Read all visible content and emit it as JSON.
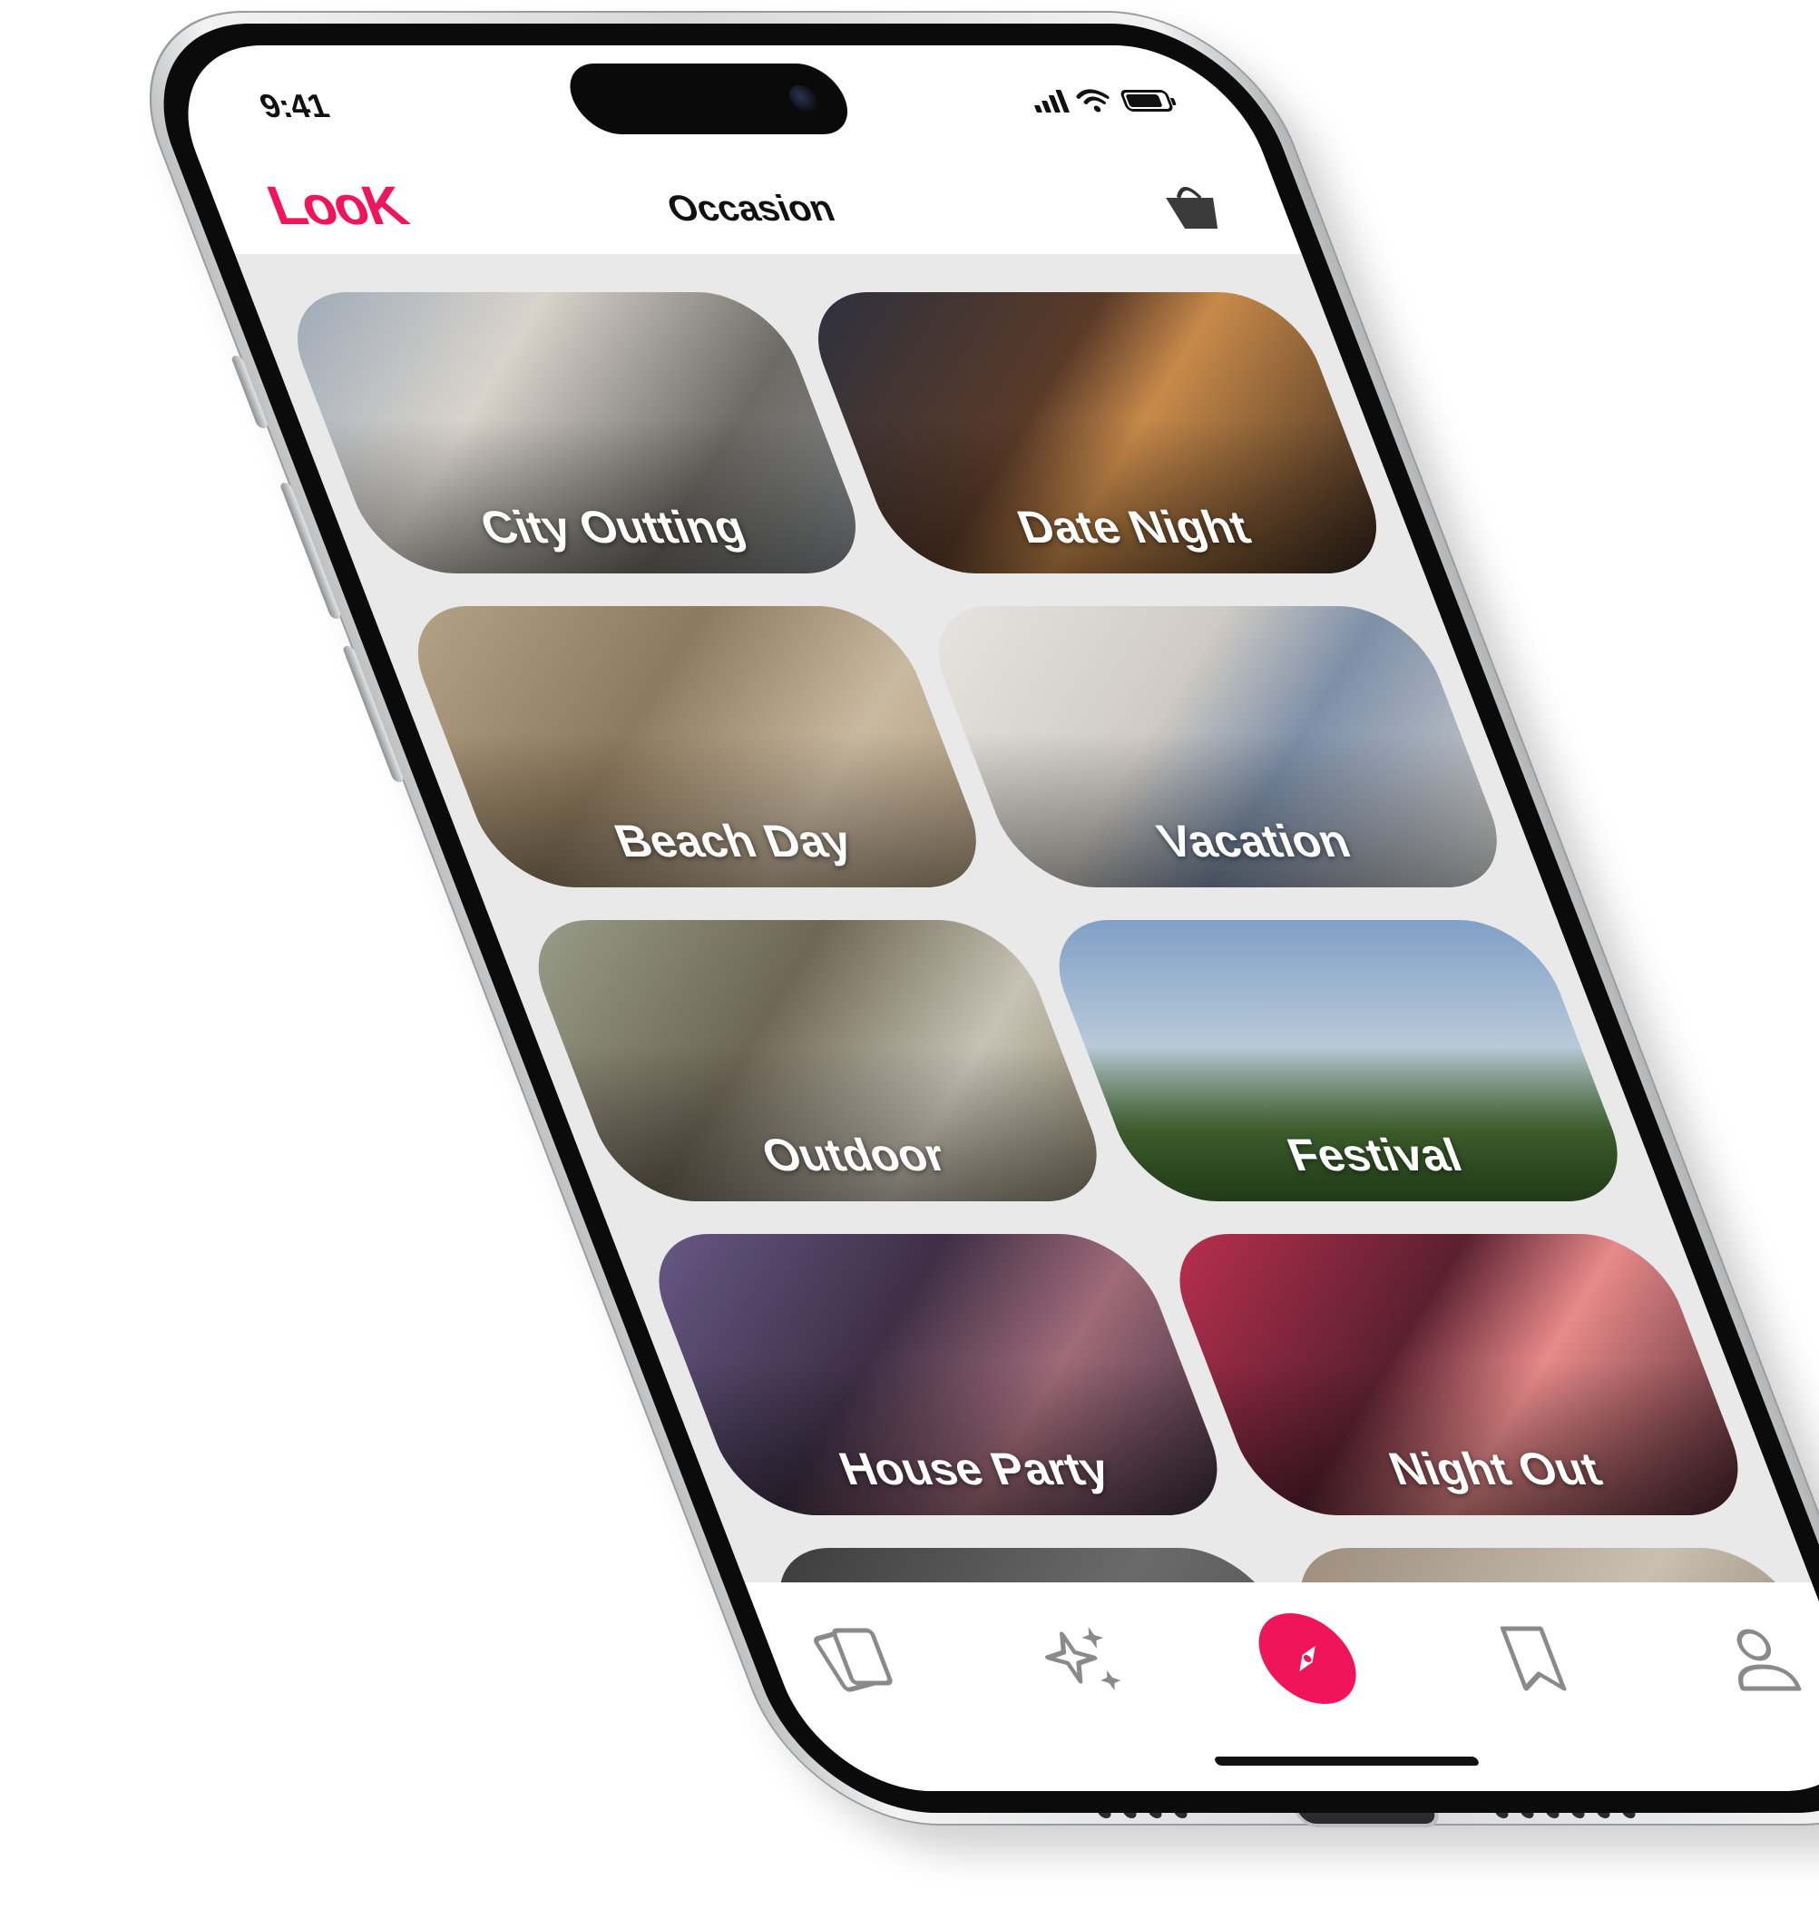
{
  "status_bar": {
    "time": "9:41"
  },
  "header": {
    "logo": "LooK",
    "title": "Occasion",
    "cart_icon": "shopping-basket-icon"
  },
  "colors": {
    "accent": "#f0155a",
    "background": "#e9e9e9"
  },
  "occasions": [
    {
      "label": "City Outting",
      "gradient": "linear-gradient(135deg,#9aa6b5 0%,#d8d4cc 35%,#6c6a64 70%,#8b8f94 100%)"
    },
    {
      "label": "Date Night",
      "gradient": "linear-gradient(135deg,#2a3040 0%,#5a3a28 40%,#c88a4a 55%,#2a1e18 100%)"
    },
    {
      "label": "Beach Day",
      "gradient": "linear-gradient(135deg,#b8a488 0%,#8d7a5e 40%,#c9b9a0 70%,#a89478 100%)"
    },
    {
      "label": "Vacation",
      "gradient": "linear-gradient(135deg,#e8e6e2 0%,#cfcbc4 40%,#7d8fa8 60%,#e0ddd8 100%)"
    },
    {
      "label": "Outdoor",
      "gradient": "linear-gradient(135deg,#9aa08c 0%,#6e6656 40%,#c7c2b4 70%,#857a66 100%)"
    },
    {
      "label": "Festival",
      "gradient": "linear-gradient(180deg,#7fa0c8 0%,#b9c9d8 45%,#4e7a3a 75%,#3c6a2c 100%)"
    },
    {
      "label": "House Party",
      "gradient": "linear-gradient(135deg,#6a5a8a 0%,#3e2f45 40%,#a06a7a 65%,#2e2530 100%)"
    },
    {
      "label": "Night Out",
      "gradient": "linear-gradient(135deg,#c03050 0%,#5a2030 40%,#e88a8a 60%,#3a1a24 100%)"
    },
    {
      "label": "",
      "gradient": "linear-gradient(135deg,#3a3a3a 0%,#6a6a6a 50%,#4a4a4a 100%)"
    },
    {
      "label": "",
      "gradient": "linear-gradient(135deg,#9a8a7a 0%,#c9c0b0 50%,#7a6a5a 100%)"
    }
  ],
  "tab_bar": {
    "tabs": [
      {
        "icon": "cards-icon"
      },
      {
        "icon": "sparkles-icon"
      },
      {
        "icon": "compass-icon",
        "active": true
      },
      {
        "icon": "bookmark-icon"
      },
      {
        "icon": "profile-icon"
      }
    ]
  }
}
